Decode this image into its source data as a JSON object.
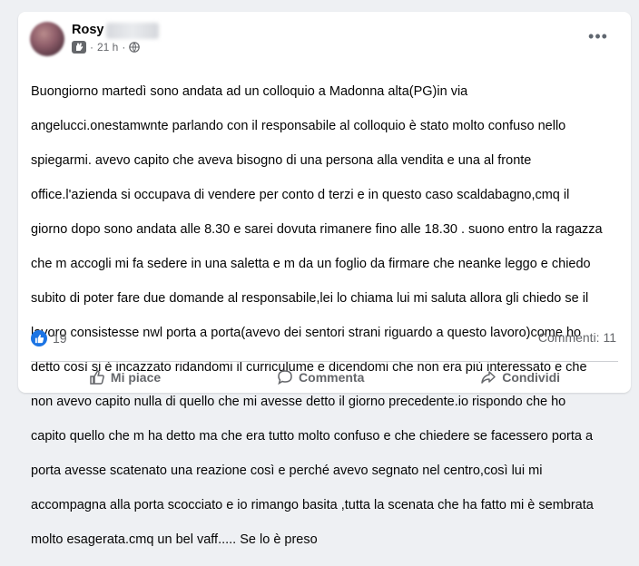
{
  "post": {
    "author": "Rosy",
    "time": "21 h",
    "text_lines": [
      "Buongiorno martedì sono andata ad un colloquio a Madonna alta(PG)in via",
      "angelucci.onestamwnte parlando con il responsabile al colloquio è stato molto confuso nello",
      "spiegarmi. avevo capito che aveva bisogno di una persona alla vendita e una al fronte",
      "office.l'azienda si occupava di vendere per conto d terzi e in questo caso scaldabagno,cmq il",
      "giorno dopo sono andata alle 8.30 e sarei dovuta rimanere fino alle 18.30 . suono entro la ragazza",
      "che m accogli mi fa sedere in una saletta e m da un foglio da firmare che neanke leggo e chiedo",
      "subito di poter fare due domande al responsabile,lei lo chiama lui mi saluta allora gli chiedo se il",
      "lavoro consistesse nwl porta a porta(avevo dei sentori strani riguardo a questo lavoro)come ho",
      "detto così si è incazzato ridandomi il curriculume e dicendomi che non era più interessato e che",
      "non avevo capito nulla di quello che mi avesse detto il giorno precedente.io rispondo che ho",
      "capito quello che m ha detto ma che era tutto molto confuso e che chiedere se facessero porta a",
      "porta avesse  scatenato una reazione così e perché avevo segnato nel centro,così lui mi",
      "accompagna alla porta scocciato e io rimango basita ,tutta la scenata che ha fatto mi è sembrata",
      "molto esagerata.cmq un bel vaff..... Se lo è preso"
    ]
  },
  "reactions": {
    "count": "19",
    "comments": "Commenti: 11"
  },
  "actions": {
    "like": "Mi piace",
    "comment": "Commenta",
    "share": "Condividi"
  },
  "colors": {
    "like_blue": "#1b74e4",
    "secondary_text": "#65676b"
  }
}
